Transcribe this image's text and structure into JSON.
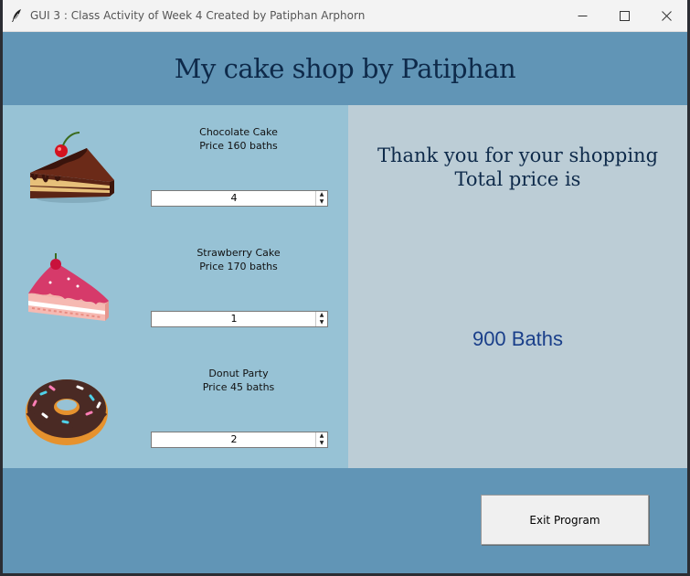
{
  "window": {
    "title": "GUI 3 : Class Activity of Week 4 Created by Patiphan Arphorn"
  },
  "header": {
    "title": "My cake shop by Patiphan"
  },
  "products": [
    {
      "name": "Chocolate Cake",
      "price": "Price 160 baths",
      "quantity": "4",
      "icon": "chocolate-cake-icon"
    },
    {
      "name": "Strawberry Cake",
      "price": "Price 170 baths",
      "quantity": "1",
      "icon": "strawberry-cake-icon"
    },
    {
      "name": "Donut Party",
      "price": "Price 45 baths",
      "quantity": "2",
      "icon": "donut-icon"
    }
  ],
  "summary": {
    "thanks_line1": "Thank you for your shopping",
    "thanks_line2": "Total price is",
    "total": "900 Baths"
  },
  "actions": {
    "exit_label": "Exit Program"
  },
  "colors": {
    "window_bg": "#6195b6",
    "left_panel": "#97c2d5",
    "right_panel": "#bccdd6",
    "title_text": "#0e2a4a",
    "total_text": "#1a3f8a"
  }
}
